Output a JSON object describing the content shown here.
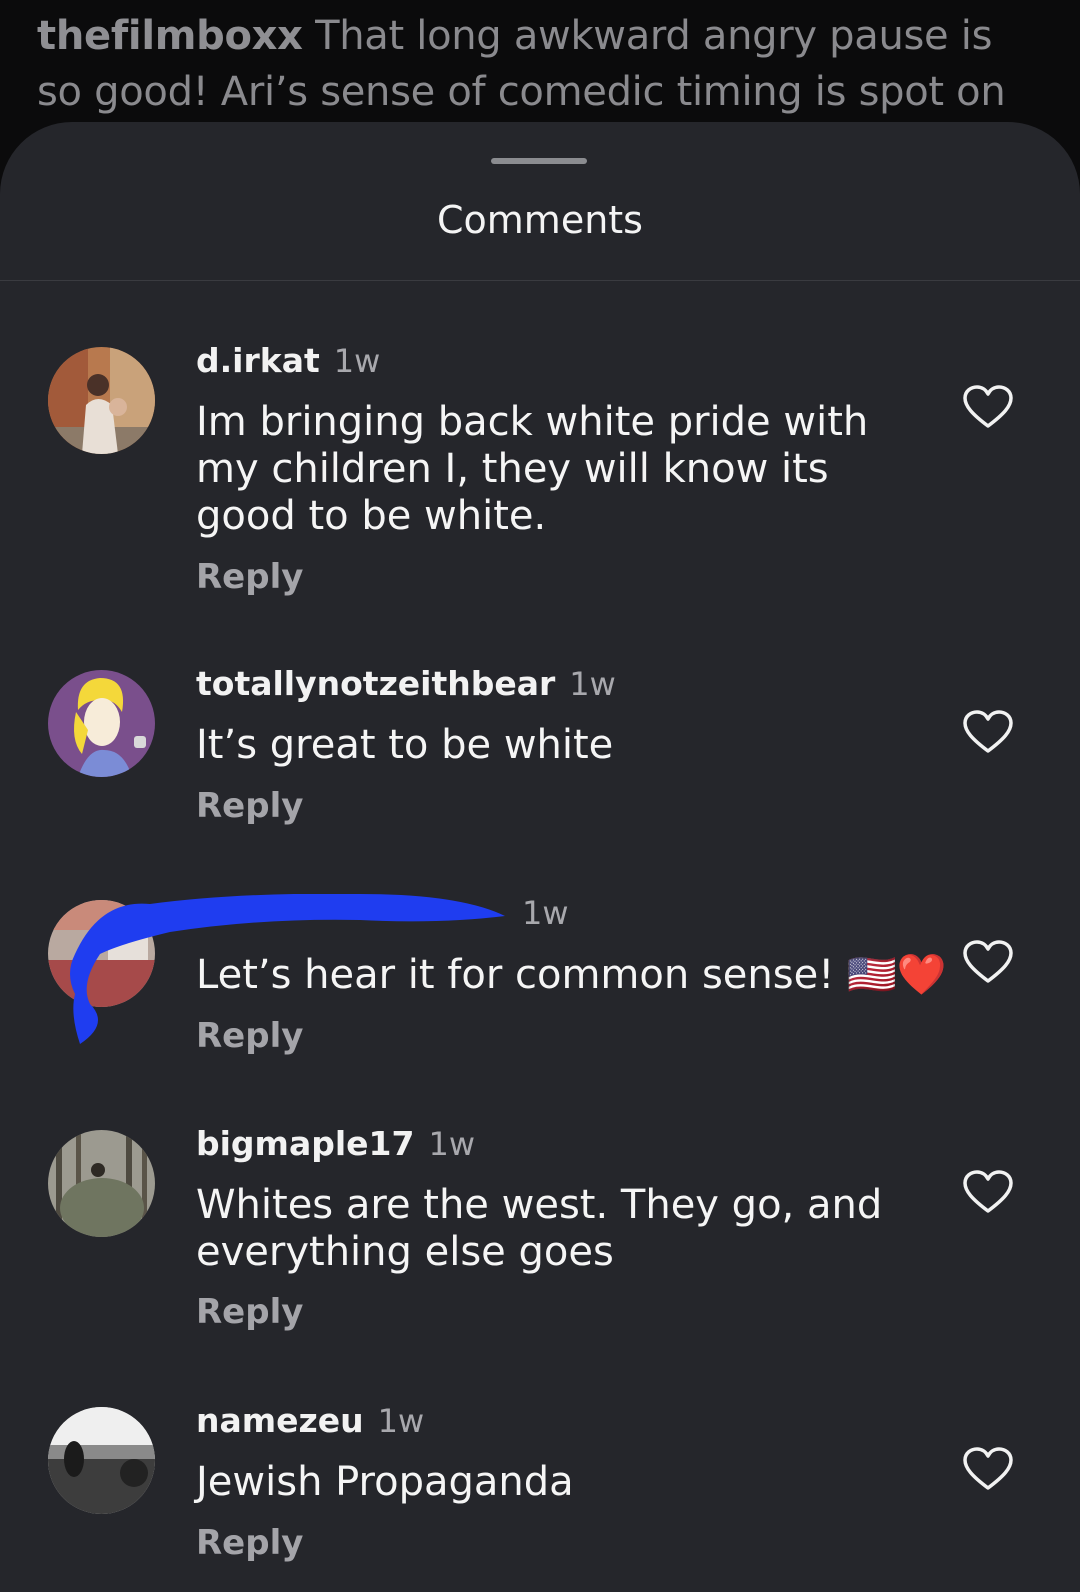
{
  "caption": {
    "username": "thefilmboxx",
    "text": "That long awkward angry pause is so good! Ari’s sense of comedic timing is spot on"
  },
  "sheet": {
    "title": "Comments"
  },
  "reply_label": "Reply",
  "comments": [
    {
      "username": "d.irkat",
      "time": "1w",
      "text": "Im bringing back white pride with my children I, they will know its good to be white.",
      "avatar_icon": "avatar-photo"
    },
    {
      "username": "totallynotzeithbear",
      "time": "1w",
      "text": "It’s great to be white",
      "avatar_icon": "avatar-cartoon"
    },
    {
      "username": "",
      "time": "1w",
      "text": "Let’s hear it for common sense! 🇺🇸❤️",
      "avatar_icon": "avatar-redacted",
      "redacted": true
    },
    {
      "username": "bigmaple17",
      "time": "1w",
      "text": "Whites are the west. They go, and everything else goes",
      "avatar_icon": "avatar-forest"
    },
    {
      "username": "namezeu",
      "time": "1w",
      "text": "Jewish Propaganda",
      "avatar_icon": "avatar-landscape"
    }
  ],
  "colors": {
    "background": "#0b0b0c",
    "sheet": "#25262b",
    "secondary_text": "#a4a4a9",
    "redaction": "#1f3df0"
  },
  "icons": {
    "like": "heart-outline-icon"
  }
}
